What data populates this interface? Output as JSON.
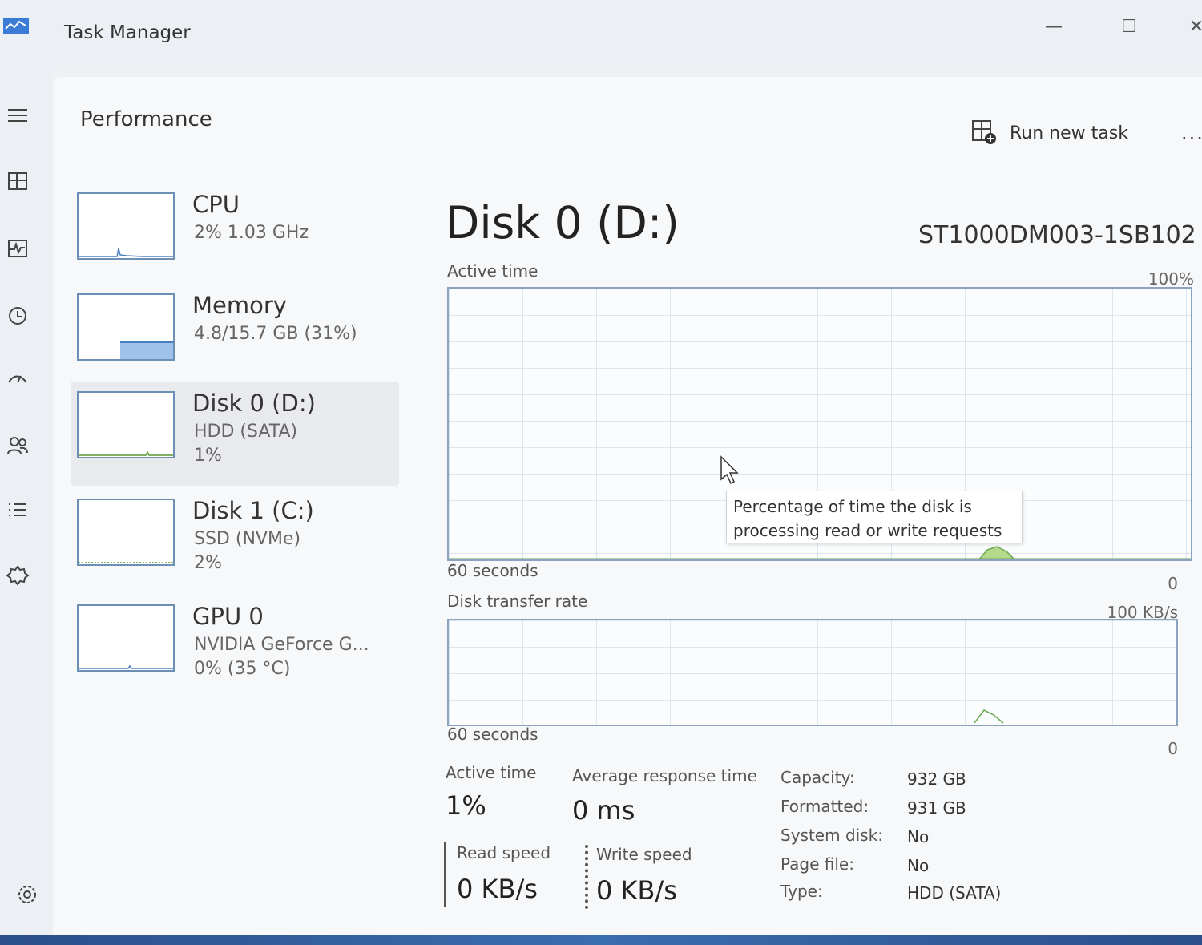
{
  "window": {
    "title": "Task Manager"
  },
  "header": {
    "title": "Performance",
    "run_task_label": "Run new task",
    "more": "..."
  },
  "devices": [
    {
      "name": "CPU",
      "line1": "2% 1.03 GHz",
      "line2": ""
    },
    {
      "name": "Memory",
      "line1": "4.8/15.7 GB (31%)",
      "line2": ""
    },
    {
      "name": "Disk 0 (D:)",
      "line1": "HDD (SATA)",
      "line2": "1%"
    },
    {
      "name": "Disk 1 (C:)",
      "line1": "SSD (NVMe)",
      "line2": "2%"
    },
    {
      "name": "GPU 0",
      "line1": "NVIDIA GeForce G...",
      "line2": "0% (35 °C)"
    }
  ],
  "selected_device": "Disk 0 (D:)",
  "detail": {
    "title": "Disk 0 (D:)",
    "model": "ST1000DM003-1SB102",
    "graph1": {
      "label": "Active time",
      "max": "100%",
      "min": "0",
      "time": "60 seconds"
    },
    "graph2": {
      "label": "Disk transfer rate",
      "max": "100 KB/s",
      "min": "0",
      "time": "60 seconds"
    },
    "tooltip": {
      "line1": "Percentage of time the disk is",
      "line2": "processing read or write requests"
    },
    "stats": {
      "active_time_label": "Active time",
      "active_time_value": "1%",
      "avg_response_label": "Average response time",
      "avg_response_value": "0 ms",
      "read_label": "Read speed",
      "read_value": "0 KB/s",
      "write_label": "Write speed",
      "write_value": "0 KB/s"
    },
    "properties": [
      {
        "key": "Capacity:",
        "value": "932 GB"
      },
      {
        "key": "Formatted:",
        "value": "931 GB"
      },
      {
        "key": "System disk:",
        "value": "No"
      },
      {
        "key": "Page file:",
        "value": "No"
      },
      {
        "key": "Type:",
        "value": "HDD (SATA)"
      }
    ]
  },
  "nav_icons": [
    "menu-icon",
    "processes-icon",
    "performance-icon",
    "app-history-icon",
    "startup-icon",
    "users-icon",
    "details-icon",
    "services-icon",
    "settings-icon"
  ],
  "colors": {
    "graph_border": "#8aa4bf",
    "memory_fill": "#9ec2ec",
    "activity_green": "#8cc63f"
  }
}
